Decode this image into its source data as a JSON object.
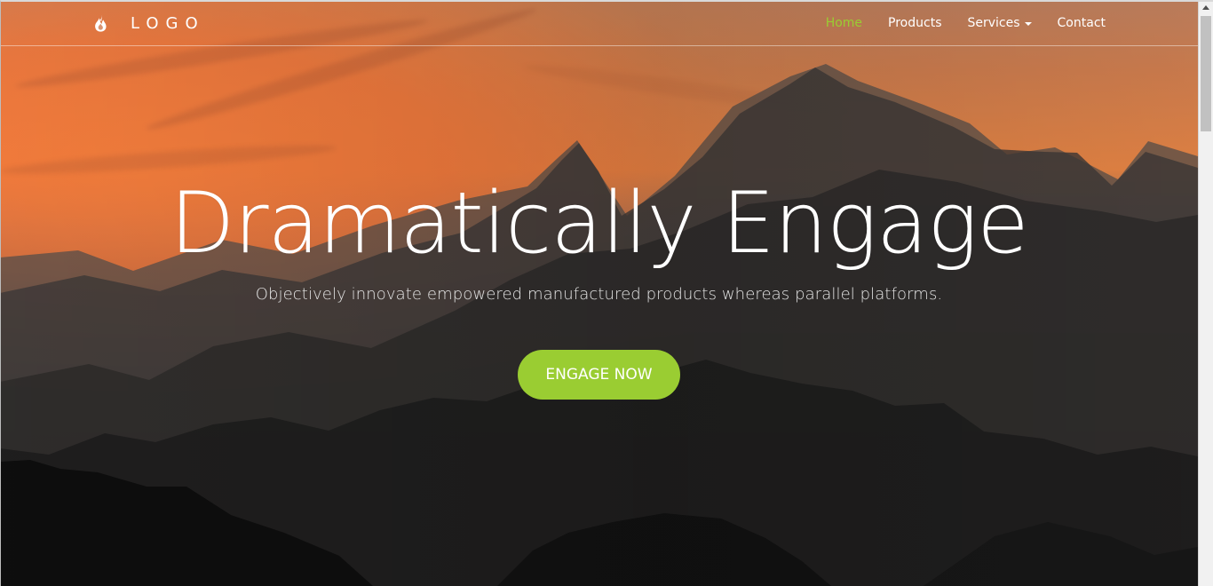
{
  "brand": {
    "text": "LOGO",
    "icon": "fire-icon"
  },
  "navigation": {
    "items": [
      {
        "label": "Home",
        "active": true
      },
      {
        "label": "Products",
        "active": false
      },
      {
        "label": "Services",
        "active": false,
        "has_dropdown": true
      },
      {
        "label": "Contact",
        "active": false
      }
    ]
  },
  "hero": {
    "headline": "Dramatically Engage",
    "subtitle": "Objectively innovate empowered manufactured products whereas parallel platforms.",
    "cta_label": "ENGAGE NOW"
  },
  "colors": {
    "accent": "#9ACD32",
    "text": "#FFFFFF",
    "subtitle": "#E3E3E3"
  },
  "icons": {
    "brand": "fire-icon",
    "dropdown": "caret-down-icon",
    "scroll_up": "scroll-up-arrow-icon"
  }
}
